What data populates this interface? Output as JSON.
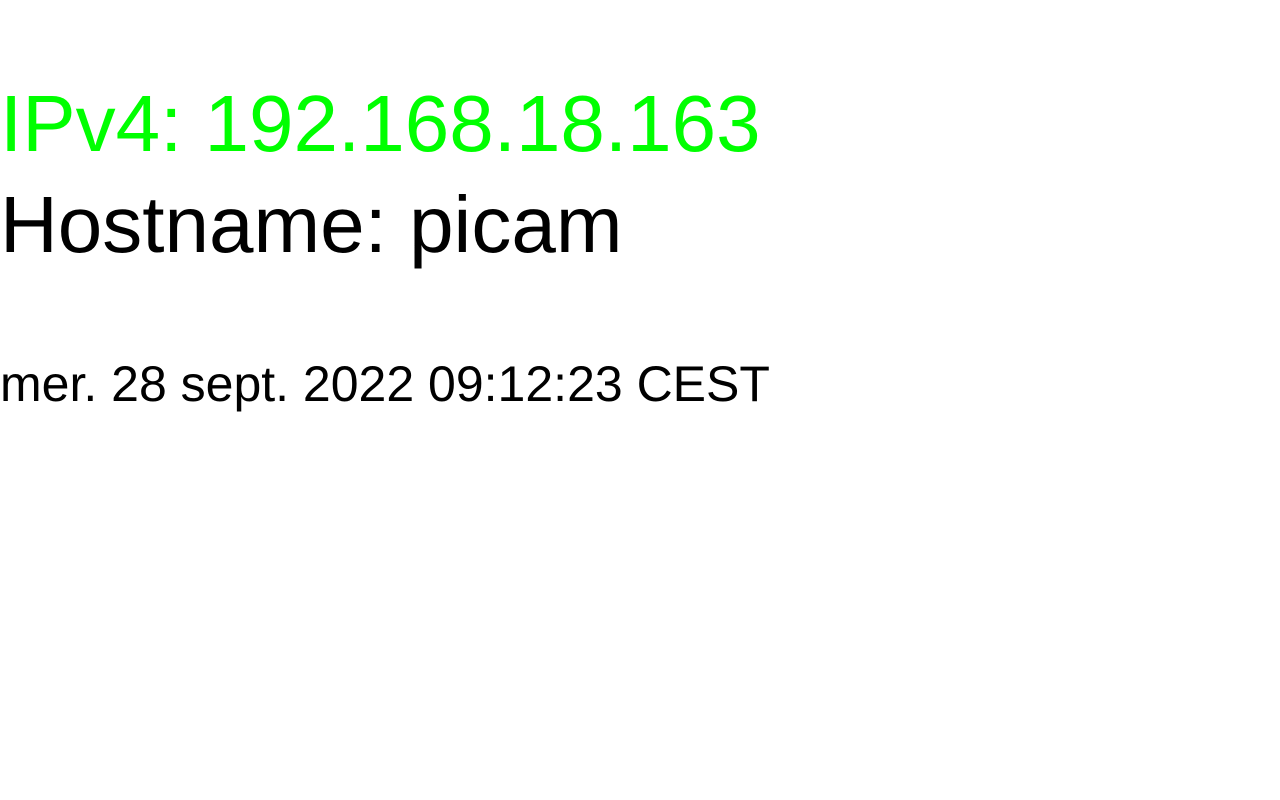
{
  "status": {
    "ipv4_text": "IPv4: 192.168.18.163",
    "ipv4_color": "#00ff00",
    "hostname_text": "Hostname: picam",
    "datetime_text": "mer. 28 sept. 2022 09:12:23 CEST"
  }
}
